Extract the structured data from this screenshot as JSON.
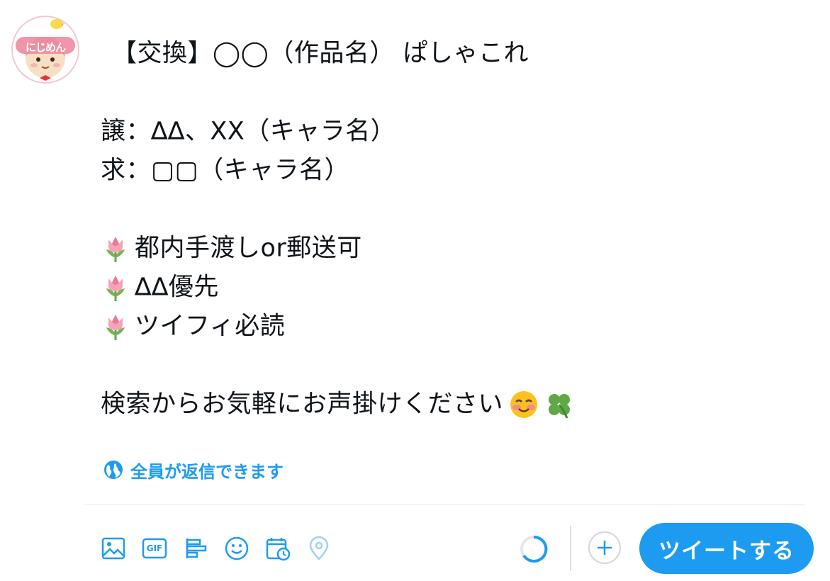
{
  "avatar": {
    "logo_text": "にじめん",
    "icon": "avatar-nijimen-logo"
  },
  "compose": {
    "lines": [
      {
        "text": "【交換】◯◯（作品名） ぱしゃこれ",
        "emoji": ""
      },
      {
        "text": "",
        "emoji": ""
      },
      {
        "text": "譲：∆∆、XX（キャラ名）",
        "emoji": ""
      },
      {
        "text": "求：▢▢（キャラ名）",
        "emoji": ""
      },
      {
        "text": "",
        "emoji": ""
      },
      {
        "text": "都内手渡しor郵送可",
        "emoji": "tulip-emoji"
      },
      {
        "text": "∆∆優先",
        "emoji": "tulip-emoji"
      },
      {
        "text": "ツイフィ必読",
        "emoji": "tulip-emoji"
      },
      {
        "text": "",
        "emoji": ""
      },
      {
        "text": "検索からお気軽にお声掛けください",
        "emoji_after": [
          "smiling-face-emoji",
          "four-leaf-clover-emoji"
        ]
      }
    ]
  },
  "reply_setting": {
    "label": "全員が返信できます",
    "icon": "globe-icon"
  },
  "toolbar": {
    "icons": [
      "image-icon",
      "gif-icon",
      "poll-icon",
      "emoji-icon",
      "schedule-icon",
      "location-icon"
    ],
    "gif_label": "GIF",
    "progress_icon": "character-count-ring",
    "add_icon": "plus-icon",
    "tweet_label": "ツイートする"
  },
  "colors": {
    "accent": "#1d9bf0",
    "text": "#0f1419",
    "divider": "#e7eaec"
  }
}
